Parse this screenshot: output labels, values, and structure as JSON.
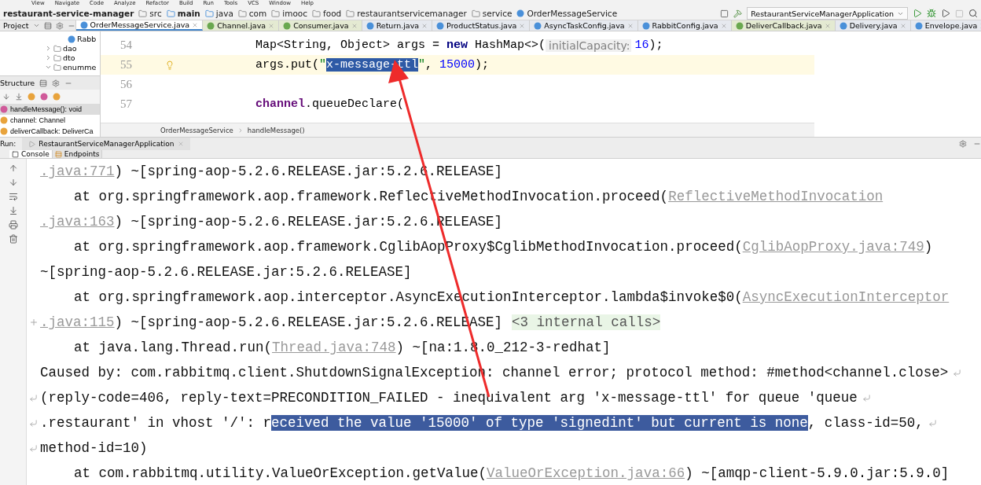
{
  "menu": [
    "View",
    "Navigate",
    "Code",
    "Analyze",
    "Refactor",
    "Build",
    "Run",
    "Tools",
    "VCS",
    "Window",
    "Help"
  ],
  "nav": {
    "project": "restaurant-service-manager",
    "crumbs": [
      {
        "label": "src",
        "kind": "folder"
      },
      {
        "label": "main",
        "kind": "source"
      },
      {
        "label": "java",
        "kind": "source"
      },
      {
        "label": "com",
        "kind": "folder"
      },
      {
        "label": "imooc",
        "kind": "folder"
      },
      {
        "label": "food",
        "kind": "folder"
      },
      {
        "label": "restaurantservicemanager",
        "kind": "folder"
      },
      {
        "label": "service",
        "kind": "folder"
      },
      {
        "label": "OrderMessageService",
        "kind": "class"
      }
    ],
    "run_config": "RestaurantServiceManagerApplication"
  },
  "project_panel": {
    "title": "Project",
    "tree": [
      {
        "label": "Rabb",
        "kind": "class"
      },
      {
        "label": "dao",
        "kind": "folder",
        "expanded": false
      },
      {
        "label": "dto",
        "kind": "folder",
        "expanded": false
      },
      {
        "label": "enumme",
        "kind": "folder",
        "expanded": true
      }
    ]
  },
  "structure": {
    "title": "Structure",
    "items": [
      {
        "label": "handleMessage(): void",
        "kind": "method",
        "selected": true
      },
      {
        "label": "channel: Channel",
        "kind": "field",
        "selected": false
      },
      {
        "label": "deliverCallback: DeliverCa",
        "kind": "field",
        "selected": false
      }
    ]
  },
  "editor_tabs": [
    {
      "label": "OrderMessageService.java",
      "kind": "class",
      "selected": true
    },
    {
      "label": "Channel.java",
      "kind": "interface",
      "selected": false
    },
    {
      "label": "Consumer.java",
      "kind": "interface",
      "selected": false
    },
    {
      "label": "Return.java",
      "kind": "class",
      "selected": false
    },
    {
      "label": "ProductStatus.java",
      "kind": "class",
      "selected": false
    },
    {
      "label": "AsyncTaskConfig.java",
      "kind": "class",
      "selected": false
    },
    {
      "label": "RabbitConfig.java",
      "kind": "class",
      "selected": false
    },
    {
      "label": "DeliverCallback.java",
      "kind": "interface",
      "selected": false
    },
    {
      "label": "Delivery.java",
      "kind": "class",
      "selected": false
    },
    {
      "label": "Envelope.java",
      "kind": "class",
      "selected": false
    }
  ],
  "editor": {
    "lines": [
      {
        "number": "54",
        "current": false,
        "tokens": [
          {
            "kind": "plain",
            "text": "Map<String, Object> args = "
          },
          {
            "kind": "keyword",
            "text": "new"
          },
          {
            "kind": "plain",
            "text": " HashMap<>("
          },
          {
            "kind": "hint",
            "text": "initialCapacity:"
          },
          {
            "kind": "number",
            "text": "16"
          },
          {
            "kind": "plain",
            "text": ");"
          }
        ]
      },
      {
        "number": "55",
        "current": true,
        "tokens": [
          {
            "kind": "plain",
            "text": "args.put("
          },
          {
            "kind": "string",
            "text": "\""
          },
          {
            "kind": "selected",
            "text": "x-message-ttl"
          },
          {
            "kind": "string",
            "text": "\""
          },
          {
            "kind": "plain",
            "text": ", "
          },
          {
            "kind": "number",
            "text": "15000"
          },
          {
            "kind": "plain",
            "text": ");"
          }
        ]
      },
      {
        "number": "56",
        "current": false
      },
      {
        "number": "57",
        "current": false,
        "tokens": [
          {
            "kind": "field",
            "text": "channel"
          },
          {
            "kind": "plain",
            "text": ".queueDeclare("
          }
        ]
      }
    ],
    "breadcrumb": [
      "OrderMessageService",
      "handleMessage()"
    ]
  },
  "run": {
    "label": "Run:",
    "config": "RestaurantServiceManagerApplication",
    "tabs": [
      {
        "label": "Console",
        "selected": true
      },
      {
        "label": "Endpoints",
        "selected": false
      }
    ]
  },
  "console": [
    {
      "indent": false,
      "fold": false,
      "wrapped": false,
      "trail": false,
      "parts": [
        {
          "kind": "link",
          "text": ".java:771"
        },
        {
          "kind": "text",
          "text": ") ~[spring-aop-5.2.6.RELEASE.jar:5.2.6.RELEASE]"
        }
      ]
    },
    {
      "indent": true,
      "fold": false,
      "wrapped": false,
      "trail": false,
      "parts": [
        {
          "kind": "text",
          "text": "at org.springframework.aop.framework.ReflectiveMethodInvocation.proceed("
        },
        {
          "kind": "link",
          "text": "ReflectiveMethodInvocation"
        }
      ]
    },
    {
      "indent": false,
      "fold": false,
      "wrapped": false,
      "trail": false,
      "parts": [
        {
          "kind": "link",
          "text": ".java:163"
        },
        {
          "kind": "text",
          "text": ") ~[spring-aop-5.2.6.RELEASE.jar:5.2.6.RELEASE]"
        }
      ]
    },
    {
      "indent": true,
      "fold": false,
      "wrapped": false,
      "trail": false,
      "parts": [
        {
          "kind": "text",
          "text": "at org.springframework.aop.framework.CglibAopProxy$CglibMethodInvocation.proceed("
        },
        {
          "kind": "link",
          "text": "CglibAopProxy.java:749"
        },
        {
          "kind": "text",
          "text": ")"
        }
      ]
    },
    {
      "indent": false,
      "fold": false,
      "wrapped": false,
      "trail": false,
      "parts": [
        {
          "kind": "text",
          "text": "~[spring-aop-5.2.6.RELEASE.jar:5.2.6.RELEASE]"
        }
      ]
    },
    {
      "indent": true,
      "fold": false,
      "wrapped": false,
      "trail": false,
      "parts": [
        {
          "kind": "text",
          "text": "at org.springframework.aop.interceptor.AsyncExecutionInterceptor.lambda$invoke$0("
        },
        {
          "kind": "link",
          "text": "AsyncExecutionInterceptor"
        }
      ]
    },
    {
      "indent": false,
      "fold": true,
      "wrapped": false,
      "trail": false,
      "parts": [
        {
          "kind": "link",
          "text": ".java:115"
        },
        {
          "kind": "text",
          "text": ") ~[spring-aop-5.2.6.RELEASE.jar:5.2.6.RELEASE]"
        },
        {
          "kind": "folded",
          "text": "<3 internal calls>"
        }
      ]
    },
    {
      "indent": true,
      "fold": false,
      "wrapped": false,
      "trail": false,
      "parts": [
        {
          "kind": "text",
          "text": "at java.lang.Thread.run("
        },
        {
          "kind": "link",
          "text": "Thread.java:748"
        },
        {
          "kind": "text",
          "text": ") ~[na:1.8.0_212-3-redhat]"
        }
      ]
    },
    {
      "indent": false,
      "fold": false,
      "wrapped": false,
      "trail": true,
      "parts": [
        {
          "kind": "text",
          "text": "Caused by: com.rabbitmq.client.ShutdownSignalException: channel error; protocol method: #method<channel.close>"
        }
      ]
    },
    {
      "indent": false,
      "fold": false,
      "wrapped": true,
      "trail": true,
      "parts": [
        {
          "kind": "text",
          "text": "(reply-code=406, reply-text=PRECONDITION_FAILED - inequivalent arg 'x-message-ttl' for queue 'queue"
        }
      ]
    },
    {
      "indent": false,
      "fold": false,
      "wrapped": true,
      "trail": true,
      "parts": [
        {
          "kind": "text",
          "text": ".restaurant' in vhost '/': r"
        },
        {
          "kind": "selected",
          "text": "eceived the value '15000' of type 'signedint' but current is none"
        },
        {
          "kind": "text",
          "text": ", class-id=50,"
        }
      ]
    },
    {
      "indent": false,
      "fold": false,
      "wrapped": true,
      "trail": false,
      "parts": [
        {
          "kind": "text",
          "text": "method-id=10)"
        }
      ]
    },
    {
      "indent": true,
      "fold": false,
      "wrapped": false,
      "trail": false,
      "parts": [
        {
          "kind": "text",
          "text": "at com.rabbitmq.utility.ValueOrException.getValue("
        },
        {
          "kind": "link",
          "text": "ValueOrException.java:66"
        },
        {
          "kind": "text",
          "text": ") ~[amqp-client-5.9.0.jar:5.9.0]"
        }
      ]
    }
  ]
}
